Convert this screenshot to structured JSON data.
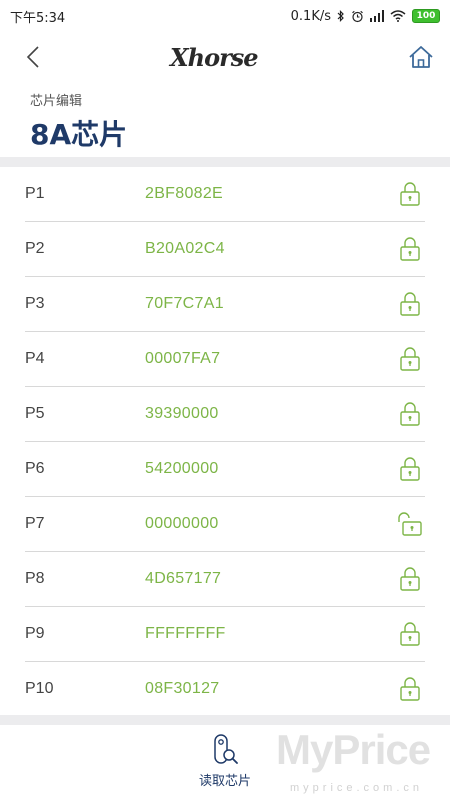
{
  "status_bar": {
    "time": "下午5:34",
    "network_speed": "0.1K/s",
    "battery": "100"
  },
  "nav": {
    "logo": "Xhorse"
  },
  "header": {
    "subtitle": "芯片编辑",
    "title": "8A芯片"
  },
  "pages": [
    {
      "label": "P1",
      "value": "2BF8082E",
      "locked": true
    },
    {
      "label": "P2",
      "value": "B20A02C4",
      "locked": true
    },
    {
      "label": "P3",
      "value": "70F7C7A1",
      "locked": true
    },
    {
      "label": "P4",
      "value": "00007FA7",
      "locked": true
    },
    {
      "label": "P5",
      "value": "39390000",
      "locked": true
    },
    {
      "label": "P6",
      "value": "54200000",
      "locked": true
    },
    {
      "label": "P7",
      "value": "00000000",
      "locked": false
    },
    {
      "label": "P8",
      "value": "4D657177",
      "locked": true
    },
    {
      "label": "P9",
      "value": "FFFFFFFF",
      "locked": true
    },
    {
      "label": "P10",
      "value": "08F30127",
      "locked": true
    }
  ],
  "actions": {
    "read_chip_label": "读取芯片"
  },
  "watermark": {
    "main": "MyPrice",
    "sub": "myprice.com.cn"
  },
  "colors": {
    "accent_green": "#7db547",
    "title_blue": "#1f3a68",
    "home_icon_blue": "#3d6a9a"
  }
}
